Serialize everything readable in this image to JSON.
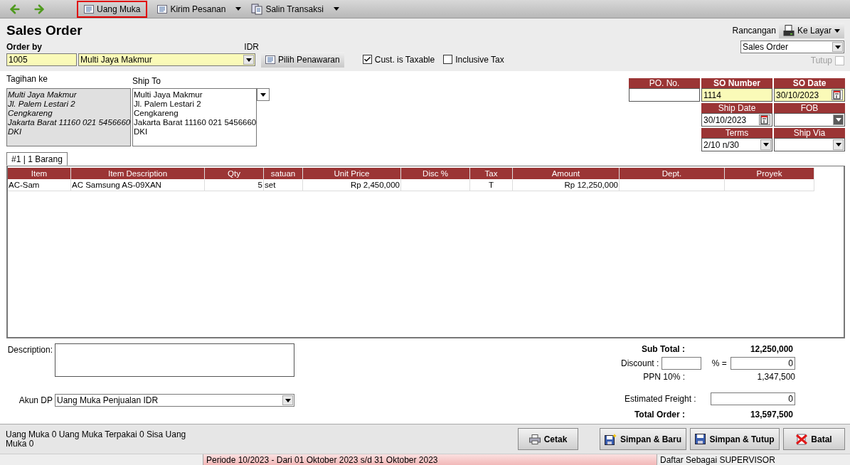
{
  "toolbar": {
    "items": [
      {
        "kind": "back"
      },
      {
        "kind": "forward"
      },
      {
        "kind": "button",
        "label": "Uang Muka",
        "highlighted": true,
        "menu": false
      },
      {
        "kind": "button",
        "label": "Kirim Pesanan",
        "highlighted": false,
        "menu": true
      },
      {
        "kind": "button",
        "label": "Salin Transaksi",
        "highlighted": false,
        "menu": true
      }
    ]
  },
  "title": "Sales Order",
  "order_by": {
    "label": "Order by",
    "customer_id": "1005",
    "customer_name": "Multi Jaya Makmur",
    "currency": "IDR",
    "quote_button": "Pilih Penawaran"
  },
  "checkboxes": [
    {
      "label": "Cust. is Taxable",
      "checked": true
    },
    {
      "label": "Inclusive Tax",
      "checked": false
    }
  ],
  "design": {
    "label": "Rancangan",
    "output_button": "Ke Layar",
    "template": "Sales Order",
    "close": {
      "label": "Tutup",
      "checked": false,
      "disabled": true
    }
  },
  "bill_to": {
    "label": "Tagihan ke",
    "lines": [
      "Multi Jaya Makmur",
      "Jl. Palem Lestari 2",
      "Cengkareng",
      "Jakarta Barat 11160 021 5456660",
      "DKI"
    ]
  },
  "ship_to": {
    "label": "Ship To",
    "lines": [
      "Multi Jaya Makmur",
      "Jl. Palem Lestari 2",
      "Cengkareng",
      "Jakarta Barat 11160 021 5456660",
      "DKI"
    ]
  },
  "fields": [
    [
      {
        "label": "PO. No.",
        "kind": "text",
        "strong": false,
        "highlighted": false
      },
      {
        "label": "SO Number",
        "kind": "text",
        "value": "1114",
        "strong": true,
        "highlighted": true
      },
      {
        "label": "SO Date",
        "kind": "date",
        "value": "30/10/2023",
        "strong": true,
        "highlighted": true
      }
    ],
    [
      {
        "label": "Ship Date",
        "kind": "date",
        "value": "30/10/2023",
        "strong": false,
        "highlighted": false
      },
      {
        "label": "FOB",
        "kind": "select",
        "strong": false,
        "highlighted": false,
        "dark_button": true
      }
    ],
    [
      {
        "label": "Terms",
        "kind": "select",
        "value": "2/10 n/30",
        "strong": false,
        "highlighted": false,
        "dark_button": false
      },
      {
        "label": "Ship Via",
        "kind": "select",
        "strong": false,
        "highlighted": false,
        "dark_button": false
      }
    ]
  ],
  "tabs": [
    {
      "label": "#1 | 1 Barang",
      "selected": true
    }
  ],
  "table": {
    "columns": [
      "Item",
      "Item Description",
      "Qty",
      "satuan",
      "Unit Price",
      "Disc %",
      "Tax",
      "Amount",
      "Dept.",
      "Proyek"
    ],
    "rows": [
      [
        "AC-Sam",
        "AC Samsung AS-09XAN",
        "5",
        "set",
        "Rp 2,450,000",
        null,
        "T",
        "Rp 12,250,000",
        null,
        null
      ]
    ]
  },
  "description": {
    "label": "Description:"
  },
  "account": {
    "label": "Akun DP",
    "value": "Uang Muka Penjualan IDR"
  },
  "totals": [
    {
      "kind": "strong",
      "label": "Sub Total :",
      "value": "12,250,000"
    },
    {
      "kind": "discount",
      "label": "Discount :",
      "separator": "% =",
      "value": "0"
    },
    {
      "kind": "plain",
      "label": "PPN 10% :",
      "value": "1,347,500"
    },
    {
      "kind": "input",
      "label": "Estimated Freight :",
      "value": "0"
    },
    {
      "kind": "strong",
      "label": "Total Order :",
      "value": "13,597,500"
    }
  ],
  "summary": "Uang Muka 0   Uang Muka Terpakai 0   Sisa Uang Muka 0",
  "actions": [
    {
      "label": "Cetak"
    },
    {
      "label": "Simpan & Baru"
    },
    {
      "label": "Simpan & Tutup"
    },
    {
      "label": "Batal"
    }
  ],
  "status_bar": {
    "period": "Periode 10/2023 - Dari 01 Oktober 2023 s/d 31 Oktober 2023",
    "user": "Daftar Sebagai SUPERVISOR"
  }
}
